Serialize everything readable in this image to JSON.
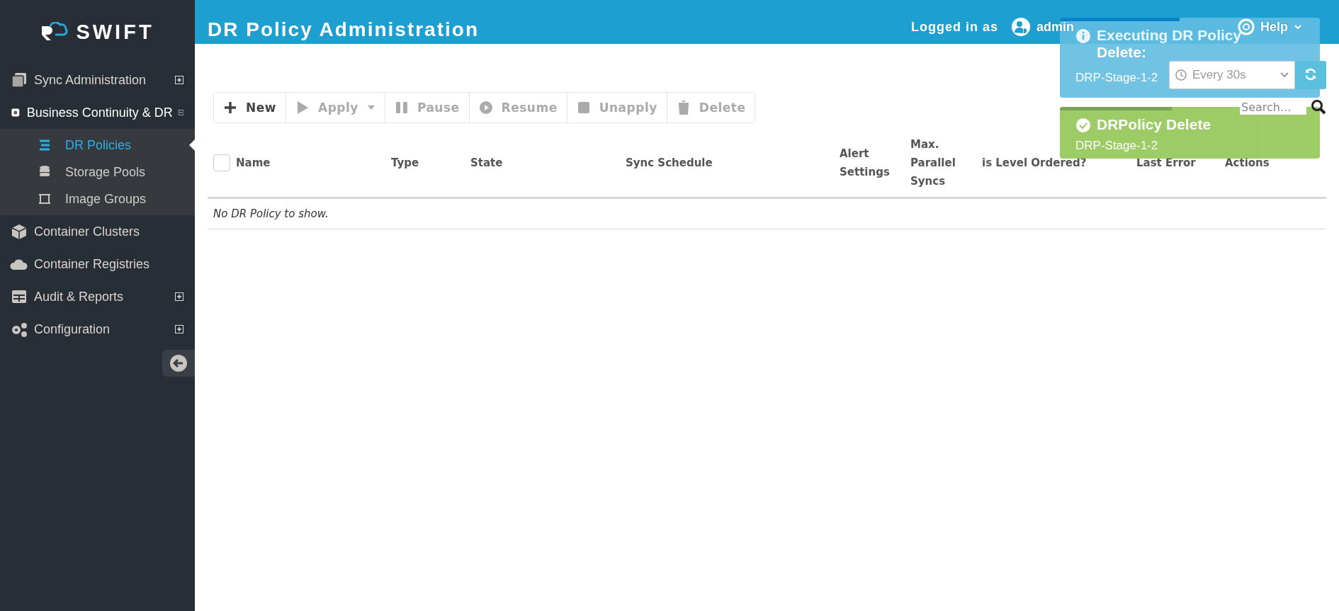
{
  "sidebar": {
    "logo": "SWIFT",
    "items": [
      {
        "label": "Sync Administration",
        "expanded": false
      },
      {
        "label": "Business Continuity & DR",
        "expanded": true,
        "children": [
          {
            "label": "DR Policies",
            "selected": true
          },
          {
            "label": "Storage Pools",
            "selected": false
          },
          {
            "label": "Image Groups",
            "selected": false
          }
        ]
      },
      {
        "label": "Container Clusters"
      },
      {
        "label": "Container Registries"
      },
      {
        "label": "Audit & Reports",
        "expanded": false
      },
      {
        "label": "Configuration",
        "expanded": false
      }
    ]
  },
  "header": {
    "title": "DR Policy Administration",
    "logged_in_label": "Logged in as",
    "user": "admin",
    "help": "Help"
  },
  "toolbar": {
    "buttons": [
      {
        "label": "New",
        "kind": "plus",
        "disabled": false
      },
      {
        "label": "Apply",
        "kind": "play",
        "disabled": true,
        "dropdown": true
      },
      {
        "label": "Pause",
        "kind": "pause",
        "disabled": true
      },
      {
        "label": "Resume",
        "kind": "resume",
        "disabled": true
      },
      {
        "label": "Unapply",
        "kind": "stop",
        "disabled": true
      },
      {
        "label": "Delete",
        "kind": "trash",
        "disabled": true
      }
    ]
  },
  "refresh": {
    "interval": "Every 30s"
  },
  "search": {
    "placeholder": "Search..."
  },
  "table": {
    "select_all": {
      "checked": false
    },
    "columns": [
      "Name",
      "Type",
      "State",
      "Sync Schedule",
      "Alert Settings",
      "Max. Parallel Syncs",
      "is Level Ordered?",
      "Last Error",
      "Actions"
    ],
    "empty_message": "No DR Policy to show."
  },
  "toasts": [
    {
      "kind": "info",
      "title": "Executing DR Policy Delete:",
      "message": "DRP-Stage-1-2",
      "level": 0.46
    },
    {
      "kind": "success",
      "title": "DRPolicy Delete",
      "message": "DRP-Stage-1-2",
      "level": 0.43
    }
  ]
}
